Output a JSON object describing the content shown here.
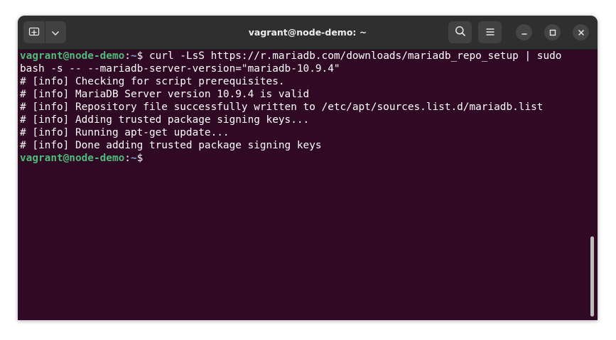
{
  "window": {
    "title": "vagrant@node-demo: ~"
  },
  "icons": {
    "new_tab": "new-tab-icon",
    "dropdown": "chevron-down-icon",
    "search": "search-icon",
    "menu": "hamburger-menu-icon",
    "minimize": "minimize-icon",
    "maximize": "maximize-icon",
    "close": "close-icon"
  },
  "colors": {
    "terminal_bg": "#300a24",
    "titlebar_bg": "#2f2f2f",
    "prompt_user": "#4ebb7a",
    "prompt_path": "#7ea0d6",
    "text": "#ffffff"
  },
  "terminal": {
    "prompt1": {
      "user": "vagrant@node-demo",
      "sep": ":",
      "path": "~",
      "symbol": "$ ",
      "command": "curl -LsS https://r.mariadb.com/downloads/mariadb_repo_setup | sudo"
    },
    "command_cont": "bash -s -- --mariadb-server-version=\"mariadb-10.9.4\"",
    "output": [
      "# [info] Checking for script prerequisites.",
      "# [info] MariaDB Server version 10.9.4 is valid",
      "# [info] Repository file successfully written to /etc/apt/sources.list.d/mariadb.list",
      "# [info] Adding trusted package signing keys...",
      "# [info] Running apt-get update...",
      "# [info] Done adding trusted package signing keys"
    ],
    "prompt2": {
      "user": "vagrant@node-demo",
      "sep": ":",
      "path": "~",
      "symbol": "$"
    }
  }
}
